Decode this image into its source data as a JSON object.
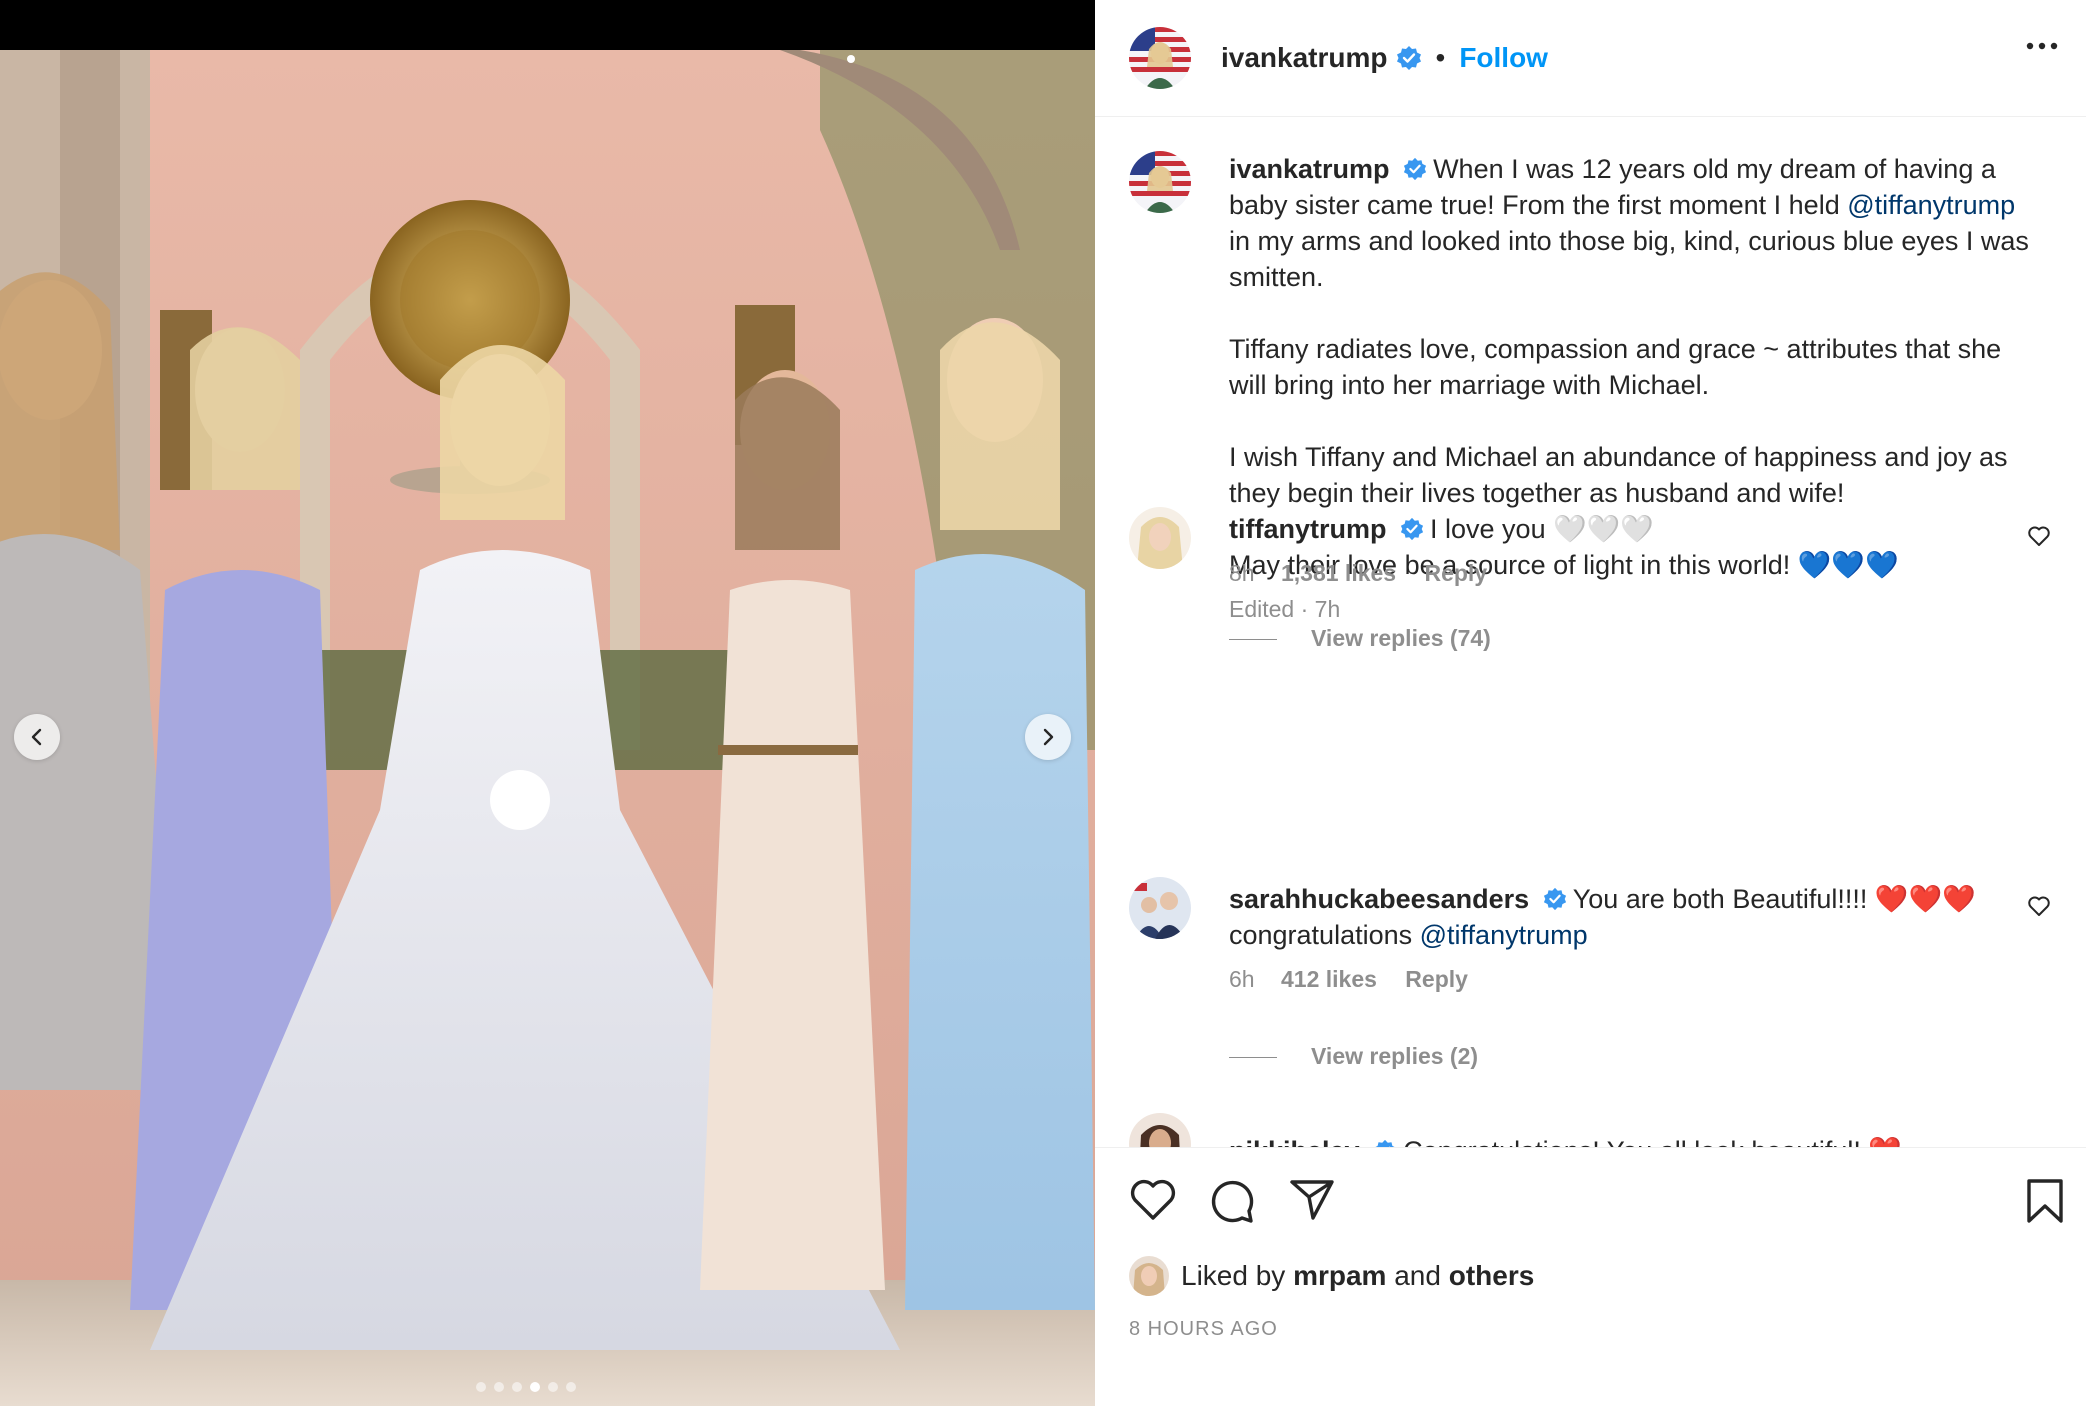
{
  "post": {
    "author": "ivankatrump",
    "follow_label": "Follow",
    "separator": "•"
  },
  "caption": {
    "username": "ivankatrump",
    "line1_before": "When I was 12 years old my dream of having a baby sister came true! From the first moment I held ",
    "mention": "@tiffanytrump",
    "line1_after": " in my arms and looked into those big, kind, curious blue eyes I was smitten.",
    "para2": "Tiffany radiates love, compassion and grace ~ attributes that she will bring into her marriage with Michael.",
    "para3": "I wish Tiffany and Michael an abundance of happiness and joy as they begin their lives together as husband and wife!",
    "para4": "May their love be a source of light in this world! 💙💙💙",
    "meta": "Edited · 7h"
  },
  "comments": [
    {
      "username": "tiffanytrump",
      "text": "I love you 🤍🤍🤍",
      "time": "8h",
      "likes": "1,381 likes",
      "reply": "Reply",
      "view_replies": "View replies (74)"
    },
    {
      "username": "sarahhuckabeesanders",
      "text": "You are both Beautiful!!!! ❤️❤️❤️",
      "text2_before": "congratulations ",
      "mention": "@tiffanytrump",
      "time": "6h",
      "likes": "412 likes",
      "reply": "Reply",
      "view_replies": "View replies (2)"
    },
    {
      "username": "nikkihaley",
      "text": "Congratulations! You all look beautiful! ❤️"
    }
  ],
  "footer": {
    "liked_prefix": "Liked by",
    "liked_user": "mrpam",
    "liked_and": "and",
    "liked_others": "others",
    "timestamp": "8 HOURS AGO"
  },
  "carousel": {
    "dot_count": 6,
    "active_index": 3
  },
  "colors": {
    "link": "#0095f6",
    "mention": "#00376b",
    "verified": "#3897f0",
    "muted": "#8e8e8e"
  },
  "icons": [
    "more-icon",
    "verified-icon",
    "heart-icon",
    "comment-icon",
    "share-icon",
    "bookmark-icon",
    "chevron-left-icon",
    "chevron-right-icon"
  ]
}
